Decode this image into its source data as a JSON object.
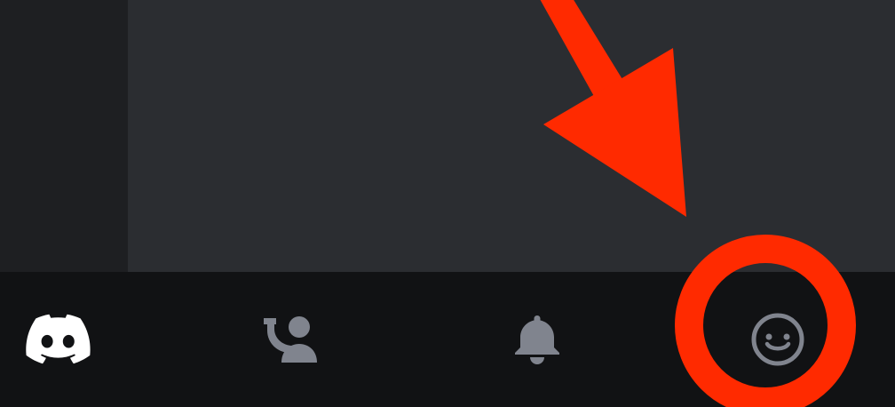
{
  "colors": {
    "background": "#1e1f22",
    "content_panel": "#2b2d31",
    "bottom_nav": "#111214",
    "icon_active": "#ffffff",
    "icon_inactive": "#80848e",
    "annotation": "#ff2a00"
  },
  "bottom_nav": {
    "items": [
      {
        "icon": "discord-logo-icon",
        "state": "active"
      },
      {
        "icon": "friends-icon",
        "state": "inactive"
      },
      {
        "icon": "notifications-bell-icon",
        "state": "inactive"
      },
      {
        "icon": "profile-smiley-icon",
        "state": "inactive",
        "highlighted": true
      }
    ]
  },
  "annotation": {
    "type": "arrow-and-circle",
    "target": "profile-smiley-icon"
  }
}
